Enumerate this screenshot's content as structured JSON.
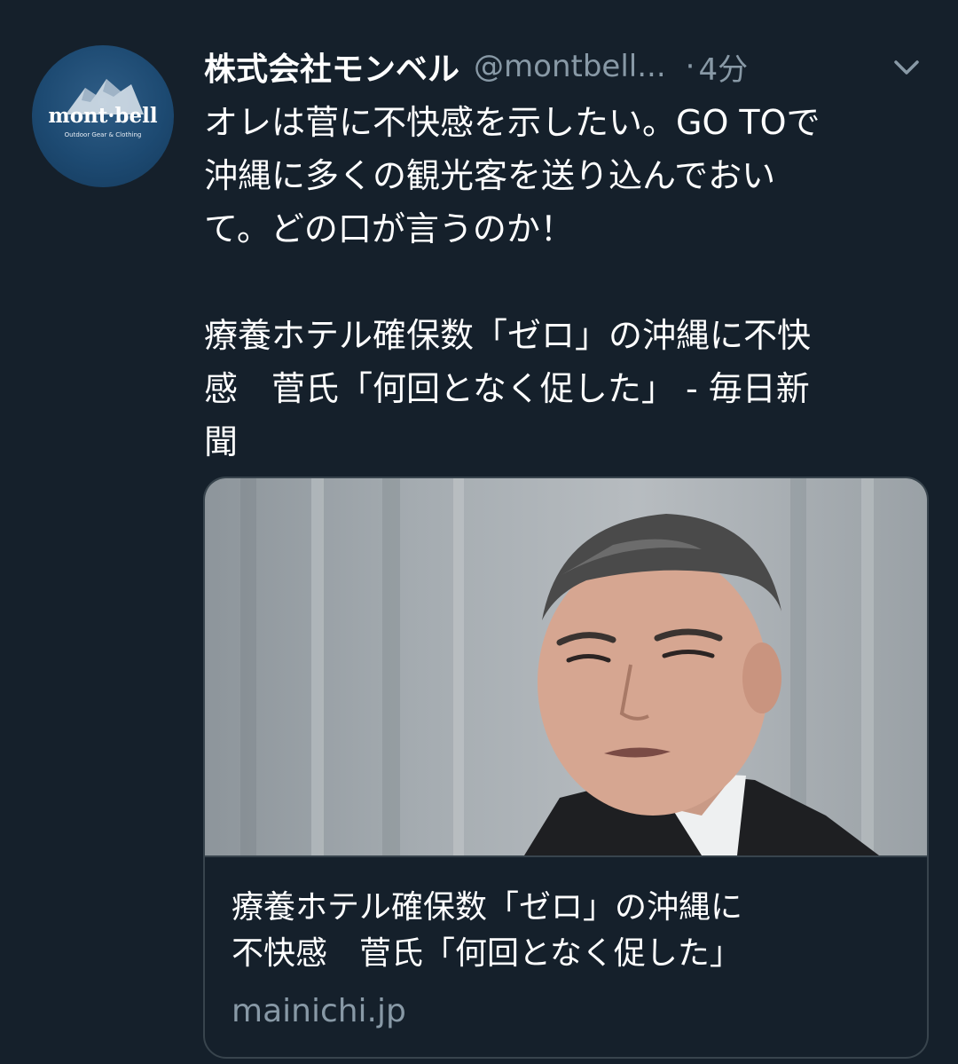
{
  "tweet": {
    "avatar": {
      "brand": "mont·bell",
      "tagline": "Outdoor Gear & Clothing"
    },
    "display_name": "株式会社モンベル",
    "handle": "@montbell...",
    "separator": "·",
    "time": "4分",
    "text": "オレは菅に不快感を示したい。GO TOで\n沖縄に多くの観光客を送り込んでおい\nて。どの口が言うのか！\n\n療養ホテル確保数「ゼロ」の沖縄に不快\n感　菅氏「何回となく促した」 - 毎日新\n聞",
    "card": {
      "title": "療養ホテル確保数「ゼロ」の沖縄に\n不快感　菅氏「何回となく促した」",
      "domain": "mainichi.jp"
    }
  },
  "colors": {
    "background": "#15202b",
    "text": "#ffffff",
    "secondary_text": "#8899a6",
    "border": "#38444d"
  },
  "icons": {
    "more_menu": "chevron-down-icon"
  }
}
